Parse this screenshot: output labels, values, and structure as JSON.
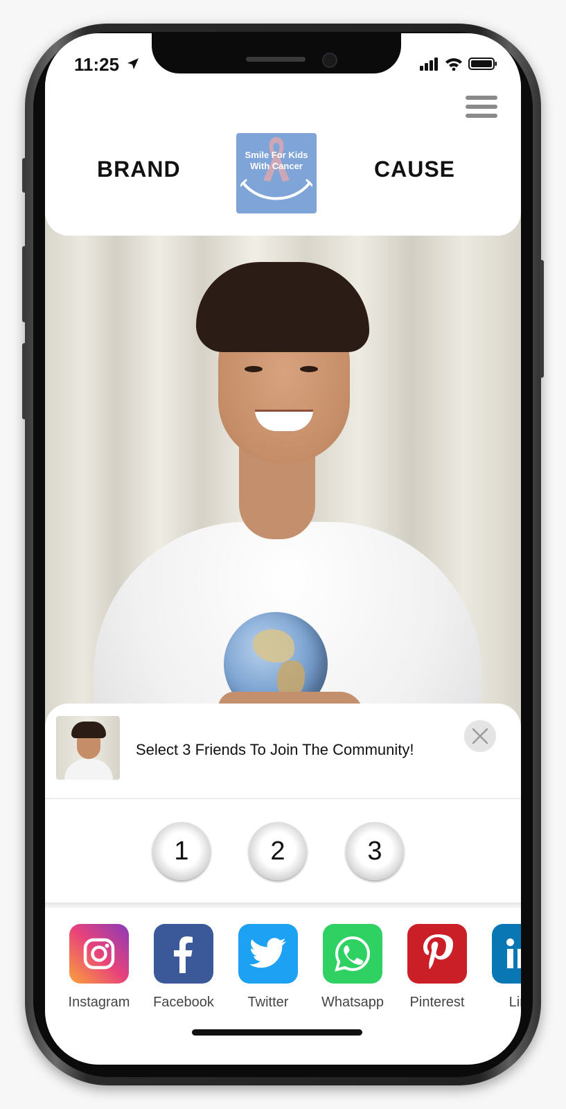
{
  "status_bar": {
    "time": "11:25",
    "icons": [
      "location-arrow-icon",
      "signal-icon",
      "wifi-icon",
      "battery-icon"
    ]
  },
  "header": {
    "brand_label": "BRAND",
    "cause_label": "CAUSE",
    "logo": {
      "line1": "Smile For Kids",
      "line2": "With Cancer",
      "background": "#7fa4d8"
    },
    "menu_icon": "hamburger-menu-icon"
  },
  "sheet": {
    "title": "Select 3 Friends To Join The Community!",
    "close_icon": "close-icon",
    "friend_slots": [
      "1",
      "2",
      "3"
    ]
  },
  "share": [
    {
      "label": "Instagram",
      "icon": "instagram-icon",
      "color": "#c13584"
    },
    {
      "label": "Facebook",
      "icon": "facebook-icon",
      "color": "#3b5998"
    },
    {
      "label": "Twitter",
      "icon": "twitter-icon",
      "color": "#1da1f2"
    },
    {
      "label": "Whatsapp",
      "icon": "whatsapp-icon",
      "color": "#2fd163"
    },
    {
      "label": "Pinterest",
      "icon": "pinterest-icon",
      "color": "#cb1f27"
    },
    {
      "label": "Link",
      "icon": "linkedin-icon",
      "color": "#0a77b5"
    }
  ]
}
